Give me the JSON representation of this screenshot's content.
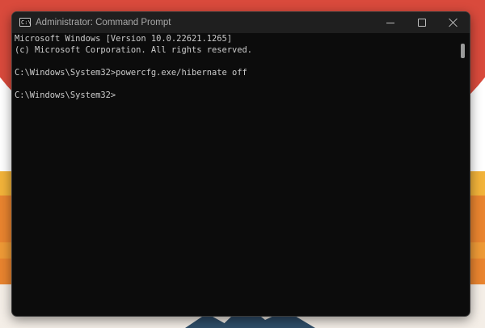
{
  "window": {
    "title": "Administrator: Command Prompt",
    "app_icon_text": "C:\\"
  },
  "console": {
    "lines": [
      "Microsoft Windows [Version 10.0.22621.1265]",
      "(c) Microsoft Corporation. All rights reserved.",
      "",
      "C:\\Windows\\System32>powercfg.exe/hibernate off",
      "",
      "C:\\Windows\\System32>"
    ]
  },
  "colors": {
    "console_background": "#0c0c0c",
    "console_text": "#cccccc",
    "titlebar": "#1f1f1f",
    "title_text": "#a8a8a8"
  }
}
